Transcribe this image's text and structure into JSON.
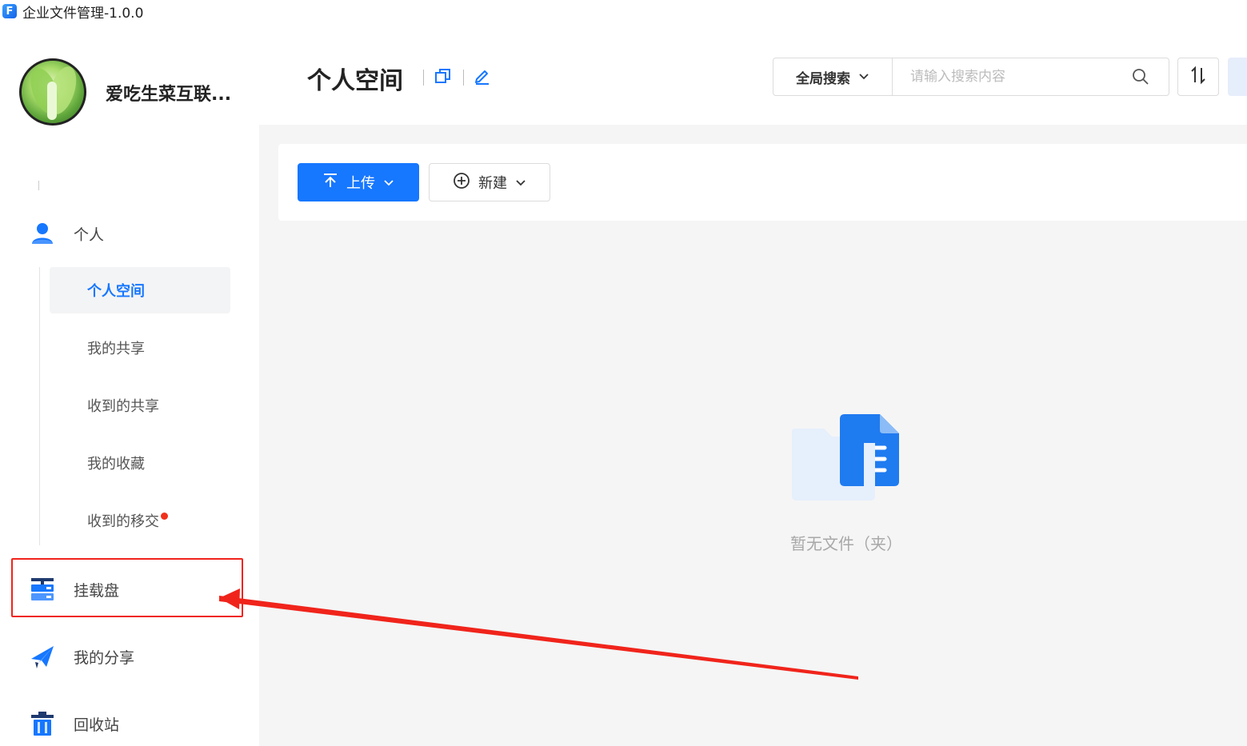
{
  "window": {
    "logo_letter": "F",
    "title": "企业文件管理-1.0.0"
  },
  "sidebar": {
    "username": "爱吃生菜互联...",
    "personal_group": "个人",
    "sub_items": [
      {
        "label": "个人空间",
        "active": true
      },
      {
        "label": "我的共享",
        "active": false
      },
      {
        "label": "收到的共享",
        "active": false
      },
      {
        "label": "我的收藏",
        "active": false
      },
      {
        "label": "收到的移交",
        "active": false,
        "has_dot": true
      }
    ],
    "mount_disk": "挂载盘",
    "my_share": "我的分享",
    "recycle": "回收站"
  },
  "header": {
    "page_title": "个人空间",
    "search_scope": "全局搜索",
    "search_placeholder": "请输入搜索内容"
  },
  "toolbar": {
    "upload_label": "上传",
    "new_label": "新建"
  },
  "main": {
    "empty_text": "暂无文件（夹）"
  },
  "colors": {
    "accent": "#1677ff",
    "annotation": "#f0241b",
    "dot": "#f0301b"
  }
}
